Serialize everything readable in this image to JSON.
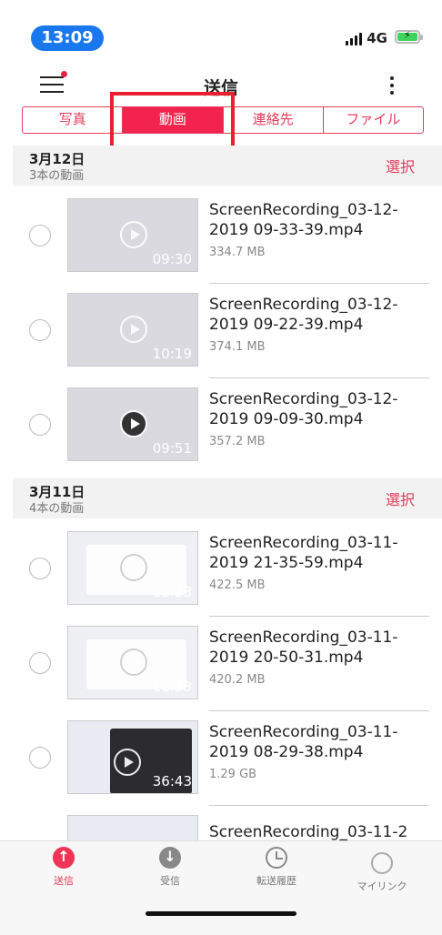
{
  "status": {
    "time": "13:09",
    "network": "4G"
  },
  "header": {
    "title": "送信"
  },
  "tabs": [
    "写真",
    "動画",
    "連絡先",
    "ファイル"
  ],
  "active_tab": "動画",
  "sections": [
    {
      "date": "3月12日",
      "count": "3本の動画",
      "select_label": "選択",
      "items": [
        {
          "name": "ScreenRecording_03-12-2019 09-33-39.mp4",
          "size": "334.7 MB",
          "duration": "09:30"
        },
        {
          "name": "ScreenRecording_03-12-2019 09-22-39.mp4",
          "size": "374.1 MB",
          "duration": "10:19"
        },
        {
          "name": "ScreenRecording_03-12-2019 09-09-30.mp4",
          "size": "357.2 MB",
          "duration": "09:51"
        }
      ]
    },
    {
      "date": "3月11日",
      "count": "4本の動画",
      "select_label": "選択",
      "items": [
        {
          "name": "ScreenRecording_03-11-2019 21-35-59.mp4",
          "size": "422.5 MB",
          "duration": "11:23"
        },
        {
          "name": "ScreenRecording_03-11-2019 20-50-31.mp4",
          "size": "420.2 MB",
          "duration": "11:33"
        },
        {
          "name": "ScreenRecording_03-11-2019 08-29-38.mp4",
          "size": "1.29 GB",
          "duration": "36:43"
        },
        {
          "name": "ScreenRecording_03-11-2",
          "size": "",
          "duration": ""
        }
      ]
    }
  ],
  "tabbar": [
    {
      "label": "送信",
      "icon": "send-icon"
    },
    {
      "label": "受信",
      "icon": "receive-icon"
    },
    {
      "label": "転送履歴",
      "icon": "history-icon"
    },
    {
      "label": "マイリンク",
      "icon": "link-icon"
    }
  ],
  "colors": {
    "accent": "#f2244d",
    "highlight": "#e8202f",
    "status_pill": "#1a78ee"
  }
}
